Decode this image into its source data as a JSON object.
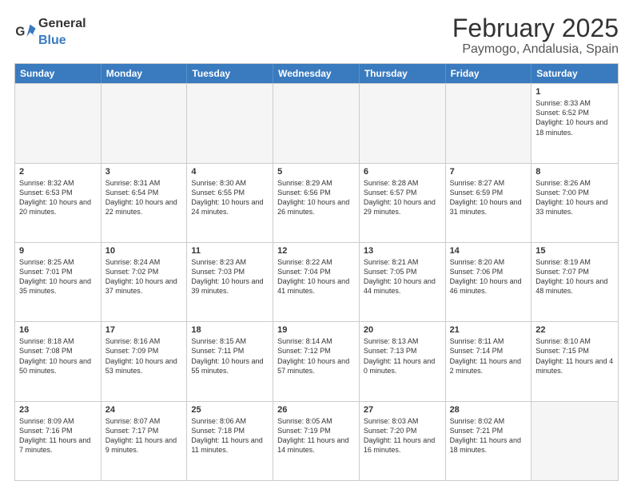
{
  "header": {
    "logo_general": "General",
    "logo_blue": "Blue",
    "month_title": "February 2025",
    "location": "Paymogo, Andalusia, Spain"
  },
  "calendar": {
    "days_of_week": [
      "Sunday",
      "Monday",
      "Tuesday",
      "Wednesday",
      "Thursday",
      "Friday",
      "Saturday"
    ],
    "rows": [
      [
        {
          "day": "",
          "text": ""
        },
        {
          "day": "",
          "text": ""
        },
        {
          "day": "",
          "text": ""
        },
        {
          "day": "",
          "text": ""
        },
        {
          "day": "",
          "text": ""
        },
        {
          "day": "",
          "text": ""
        },
        {
          "day": "1",
          "text": "Sunrise: 8:33 AM\nSunset: 6:52 PM\nDaylight: 10 hours and 18 minutes."
        }
      ],
      [
        {
          "day": "2",
          "text": "Sunrise: 8:32 AM\nSunset: 6:53 PM\nDaylight: 10 hours and 20 minutes."
        },
        {
          "day": "3",
          "text": "Sunrise: 8:31 AM\nSunset: 6:54 PM\nDaylight: 10 hours and 22 minutes."
        },
        {
          "day": "4",
          "text": "Sunrise: 8:30 AM\nSunset: 6:55 PM\nDaylight: 10 hours and 24 minutes."
        },
        {
          "day": "5",
          "text": "Sunrise: 8:29 AM\nSunset: 6:56 PM\nDaylight: 10 hours and 26 minutes."
        },
        {
          "day": "6",
          "text": "Sunrise: 8:28 AM\nSunset: 6:57 PM\nDaylight: 10 hours and 29 minutes."
        },
        {
          "day": "7",
          "text": "Sunrise: 8:27 AM\nSunset: 6:59 PM\nDaylight: 10 hours and 31 minutes."
        },
        {
          "day": "8",
          "text": "Sunrise: 8:26 AM\nSunset: 7:00 PM\nDaylight: 10 hours and 33 minutes."
        }
      ],
      [
        {
          "day": "9",
          "text": "Sunrise: 8:25 AM\nSunset: 7:01 PM\nDaylight: 10 hours and 35 minutes."
        },
        {
          "day": "10",
          "text": "Sunrise: 8:24 AM\nSunset: 7:02 PM\nDaylight: 10 hours and 37 minutes."
        },
        {
          "day": "11",
          "text": "Sunrise: 8:23 AM\nSunset: 7:03 PM\nDaylight: 10 hours and 39 minutes."
        },
        {
          "day": "12",
          "text": "Sunrise: 8:22 AM\nSunset: 7:04 PM\nDaylight: 10 hours and 41 minutes."
        },
        {
          "day": "13",
          "text": "Sunrise: 8:21 AM\nSunset: 7:05 PM\nDaylight: 10 hours and 44 minutes."
        },
        {
          "day": "14",
          "text": "Sunrise: 8:20 AM\nSunset: 7:06 PM\nDaylight: 10 hours and 46 minutes."
        },
        {
          "day": "15",
          "text": "Sunrise: 8:19 AM\nSunset: 7:07 PM\nDaylight: 10 hours and 48 minutes."
        }
      ],
      [
        {
          "day": "16",
          "text": "Sunrise: 8:18 AM\nSunset: 7:08 PM\nDaylight: 10 hours and 50 minutes."
        },
        {
          "day": "17",
          "text": "Sunrise: 8:16 AM\nSunset: 7:09 PM\nDaylight: 10 hours and 53 minutes."
        },
        {
          "day": "18",
          "text": "Sunrise: 8:15 AM\nSunset: 7:11 PM\nDaylight: 10 hours and 55 minutes."
        },
        {
          "day": "19",
          "text": "Sunrise: 8:14 AM\nSunset: 7:12 PM\nDaylight: 10 hours and 57 minutes."
        },
        {
          "day": "20",
          "text": "Sunrise: 8:13 AM\nSunset: 7:13 PM\nDaylight: 11 hours and 0 minutes."
        },
        {
          "day": "21",
          "text": "Sunrise: 8:11 AM\nSunset: 7:14 PM\nDaylight: 11 hours and 2 minutes."
        },
        {
          "day": "22",
          "text": "Sunrise: 8:10 AM\nSunset: 7:15 PM\nDaylight: 11 hours and 4 minutes."
        }
      ],
      [
        {
          "day": "23",
          "text": "Sunrise: 8:09 AM\nSunset: 7:16 PM\nDaylight: 11 hours and 7 minutes."
        },
        {
          "day": "24",
          "text": "Sunrise: 8:07 AM\nSunset: 7:17 PM\nDaylight: 11 hours and 9 minutes."
        },
        {
          "day": "25",
          "text": "Sunrise: 8:06 AM\nSunset: 7:18 PM\nDaylight: 11 hours and 11 minutes."
        },
        {
          "day": "26",
          "text": "Sunrise: 8:05 AM\nSunset: 7:19 PM\nDaylight: 11 hours and 14 minutes."
        },
        {
          "day": "27",
          "text": "Sunrise: 8:03 AM\nSunset: 7:20 PM\nDaylight: 11 hours and 16 minutes."
        },
        {
          "day": "28",
          "text": "Sunrise: 8:02 AM\nSunset: 7:21 PM\nDaylight: 11 hours and 18 minutes."
        },
        {
          "day": "",
          "text": ""
        }
      ]
    ]
  }
}
